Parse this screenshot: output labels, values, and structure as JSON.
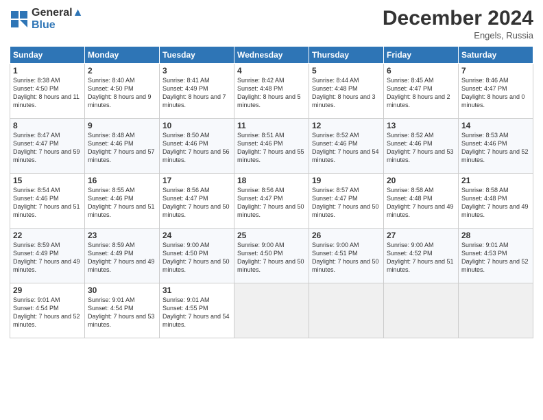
{
  "header": {
    "logo_line1": "General",
    "logo_line2": "Blue",
    "month_title": "December 2024",
    "location": "Engels, Russia"
  },
  "weekdays": [
    "Sunday",
    "Monday",
    "Tuesday",
    "Wednesday",
    "Thursday",
    "Friday",
    "Saturday"
  ],
  "weeks": [
    [
      {
        "day": "1",
        "sunrise": "Sunrise: 8:38 AM",
        "sunset": "Sunset: 4:50 PM",
        "daylight": "Daylight: 8 hours and 11 minutes."
      },
      {
        "day": "2",
        "sunrise": "Sunrise: 8:40 AM",
        "sunset": "Sunset: 4:50 PM",
        "daylight": "Daylight: 8 hours and 9 minutes."
      },
      {
        "day": "3",
        "sunrise": "Sunrise: 8:41 AM",
        "sunset": "Sunset: 4:49 PM",
        "daylight": "Daylight: 8 hours and 7 minutes."
      },
      {
        "day": "4",
        "sunrise": "Sunrise: 8:42 AM",
        "sunset": "Sunset: 4:48 PM",
        "daylight": "Daylight: 8 hours and 5 minutes."
      },
      {
        "day": "5",
        "sunrise": "Sunrise: 8:44 AM",
        "sunset": "Sunset: 4:48 PM",
        "daylight": "Daylight: 8 hours and 3 minutes."
      },
      {
        "day": "6",
        "sunrise": "Sunrise: 8:45 AM",
        "sunset": "Sunset: 4:47 PM",
        "daylight": "Daylight: 8 hours and 2 minutes."
      },
      {
        "day": "7",
        "sunrise": "Sunrise: 8:46 AM",
        "sunset": "Sunset: 4:47 PM",
        "daylight": "Daylight: 8 hours and 0 minutes."
      }
    ],
    [
      {
        "day": "8",
        "sunrise": "Sunrise: 8:47 AM",
        "sunset": "Sunset: 4:47 PM",
        "daylight": "Daylight: 7 hours and 59 minutes."
      },
      {
        "day": "9",
        "sunrise": "Sunrise: 8:48 AM",
        "sunset": "Sunset: 4:46 PM",
        "daylight": "Daylight: 7 hours and 57 minutes."
      },
      {
        "day": "10",
        "sunrise": "Sunrise: 8:50 AM",
        "sunset": "Sunset: 4:46 PM",
        "daylight": "Daylight: 7 hours and 56 minutes."
      },
      {
        "day": "11",
        "sunrise": "Sunrise: 8:51 AM",
        "sunset": "Sunset: 4:46 PM",
        "daylight": "Daylight: 7 hours and 55 minutes."
      },
      {
        "day": "12",
        "sunrise": "Sunrise: 8:52 AM",
        "sunset": "Sunset: 4:46 PM",
        "daylight": "Daylight: 7 hours and 54 minutes."
      },
      {
        "day": "13",
        "sunrise": "Sunrise: 8:52 AM",
        "sunset": "Sunset: 4:46 PM",
        "daylight": "Daylight: 7 hours and 53 minutes."
      },
      {
        "day": "14",
        "sunrise": "Sunrise: 8:53 AM",
        "sunset": "Sunset: 4:46 PM",
        "daylight": "Daylight: 7 hours and 52 minutes."
      }
    ],
    [
      {
        "day": "15",
        "sunrise": "Sunrise: 8:54 AM",
        "sunset": "Sunset: 4:46 PM",
        "daylight": "Daylight: 7 hours and 51 minutes."
      },
      {
        "day": "16",
        "sunrise": "Sunrise: 8:55 AM",
        "sunset": "Sunset: 4:46 PM",
        "daylight": "Daylight: 7 hours and 51 minutes."
      },
      {
        "day": "17",
        "sunrise": "Sunrise: 8:56 AM",
        "sunset": "Sunset: 4:47 PM",
        "daylight": "Daylight: 7 hours and 50 minutes."
      },
      {
        "day": "18",
        "sunrise": "Sunrise: 8:56 AM",
        "sunset": "Sunset: 4:47 PM",
        "daylight": "Daylight: 7 hours and 50 minutes."
      },
      {
        "day": "19",
        "sunrise": "Sunrise: 8:57 AM",
        "sunset": "Sunset: 4:47 PM",
        "daylight": "Daylight: 7 hours and 50 minutes."
      },
      {
        "day": "20",
        "sunrise": "Sunrise: 8:58 AM",
        "sunset": "Sunset: 4:48 PM",
        "daylight": "Daylight: 7 hours and 49 minutes."
      },
      {
        "day": "21",
        "sunrise": "Sunrise: 8:58 AM",
        "sunset": "Sunset: 4:48 PM",
        "daylight": "Daylight: 7 hours and 49 minutes."
      }
    ],
    [
      {
        "day": "22",
        "sunrise": "Sunrise: 8:59 AM",
        "sunset": "Sunset: 4:49 PM",
        "daylight": "Daylight: 7 hours and 49 minutes."
      },
      {
        "day": "23",
        "sunrise": "Sunrise: 8:59 AM",
        "sunset": "Sunset: 4:49 PM",
        "daylight": "Daylight: 7 hours and 49 minutes."
      },
      {
        "day": "24",
        "sunrise": "Sunrise: 9:00 AM",
        "sunset": "Sunset: 4:50 PM",
        "daylight": "Daylight: 7 hours and 50 minutes."
      },
      {
        "day": "25",
        "sunrise": "Sunrise: 9:00 AM",
        "sunset": "Sunset: 4:50 PM",
        "daylight": "Daylight: 7 hours and 50 minutes."
      },
      {
        "day": "26",
        "sunrise": "Sunrise: 9:00 AM",
        "sunset": "Sunset: 4:51 PM",
        "daylight": "Daylight: 7 hours and 50 minutes."
      },
      {
        "day": "27",
        "sunrise": "Sunrise: 9:00 AM",
        "sunset": "Sunset: 4:52 PM",
        "daylight": "Daylight: 7 hours and 51 minutes."
      },
      {
        "day": "28",
        "sunrise": "Sunrise: 9:01 AM",
        "sunset": "Sunset: 4:53 PM",
        "daylight": "Daylight: 7 hours and 52 minutes."
      }
    ],
    [
      {
        "day": "29",
        "sunrise": "Sunrise: 9:01 AM",
        "sunset": "Sunset: 4:54 PM",
        "daylight": "Daylight: 7 hours and 52 minutes."
      },
      {
        "day": "30",
        "sunrise": "Sunrise: 9:01 AM",
        "sunset": "Sunset: 4:54 PM",
        "daylight": "Daylight: 7 hours and 53 minutes."
      },
      {
        "day": "31",
        "sunrise": "Sunrise: 9:01 AM",
        "sunset": "Sunset: 4:55 PM",
        "daylight": "Daylight: 7 hours and 54 minutes."
      },
      null,
      null,
      null,
      null
    ]
  ]
}
